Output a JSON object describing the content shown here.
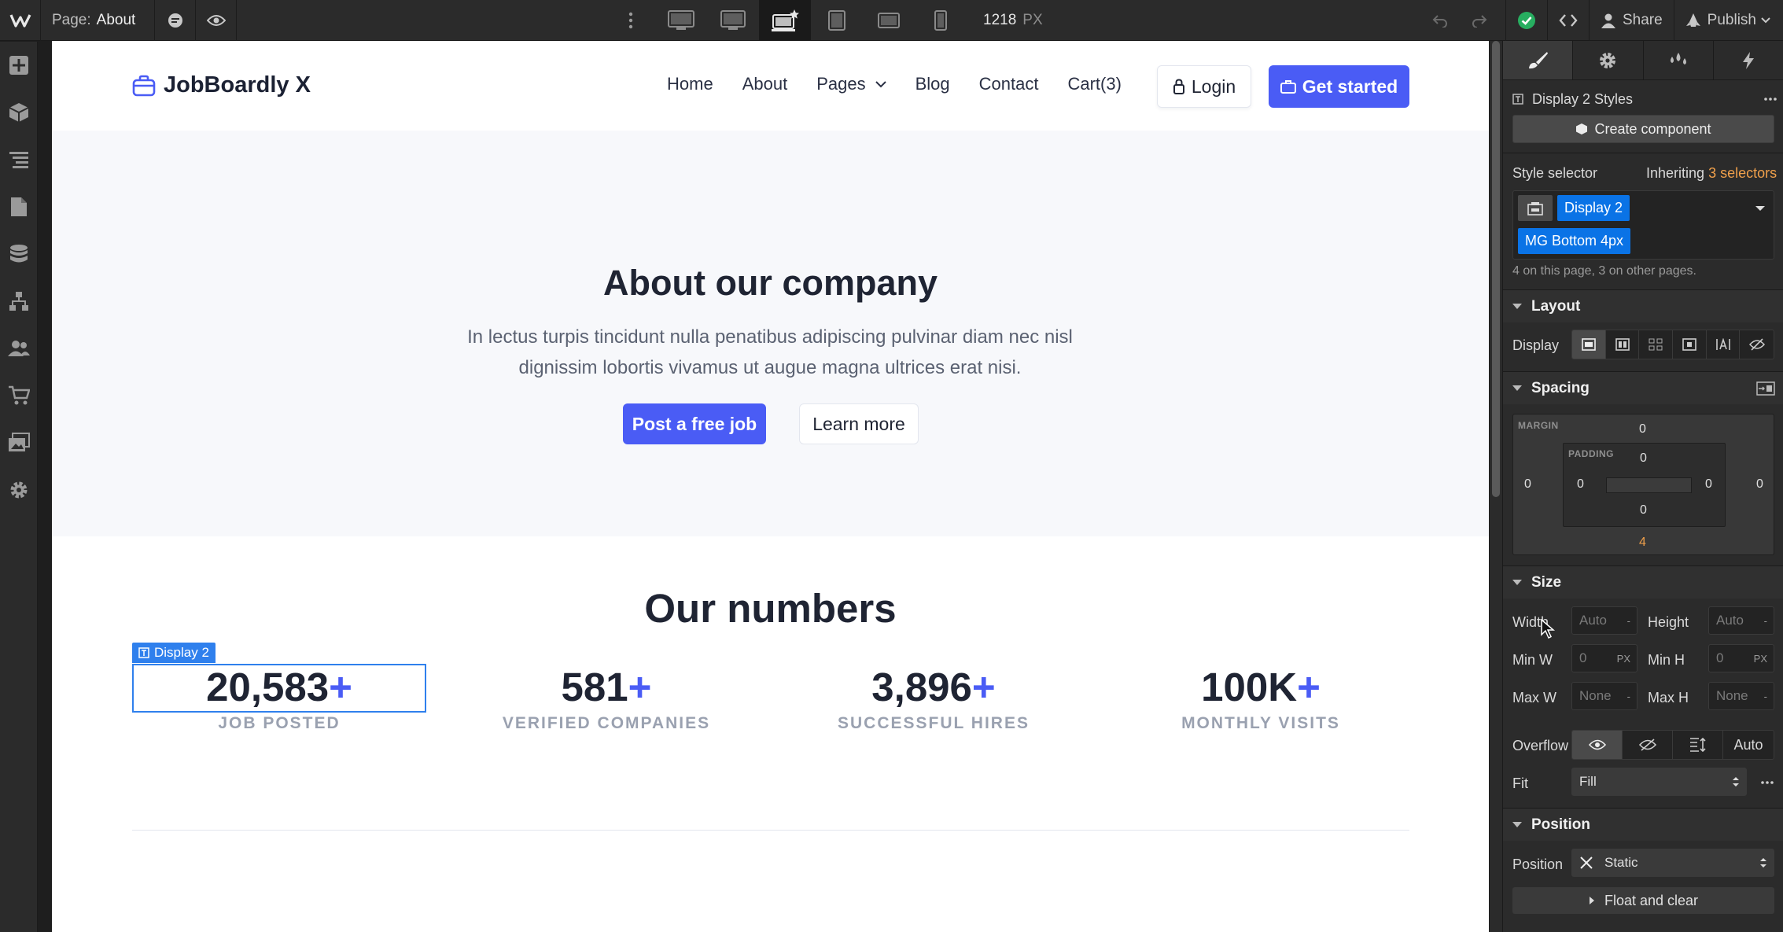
{
  "topbar": {
    "page_prefix": "Page:",
    "page_name": "About",
    "canvas_width": "1218",
    "canvas_unit": "PX",
    "share_label": "Share",
    "publish_label": "Publish"
  },
  "site": {
    "brand": "JobBoardly X",
    "menu": [
      "Home",
      "About",
      "Pages",
      "Blog",
      "Contact",
      "Cart(3)"
    ],
    "login_label": "Login",
    "get_started_label": "Get started",
    "hero_title": "About our company",
    "hero_text": "In lectus turpis tincidunt nulla penatibus adipiscing pulvinar diam nec nisl dignissim lobortis vivamus ut augue magna ultrices erat nisi.",
    "post_job_label": "Post a free job",
    "learn_more_label": "Learn more",
    "numbers_title": "Our numbers",
    "selected_tag": "Display 2",
    "stats": [
      {
        "value": "20,583",
        "plus": "+",
        "label": "JOB POSTED"
      },
      {
        "value": "581",
        "plus": "+",
        "label": "VERIFIED COMPANIES"
      },
      {
        "value": "3,896",
        "plus": "+",
        "label": "SUCCESSFUL HIRES"
      },
      {
        "value": "100K",
        "plus": "+",
        "label": "MONTHLY VISITS"
      }
    ]
  },
  "panel": {
    "styles_title": "Display 2 Styles",
    "create_component": "Create component",
    "style_selector": "Style selector",
    "inheriting": "Inheriting",
    "selectors_count": "3 selectors",
    "chip1": "Display 2",
    "chip2": "MG Bottom 4px",
    "usage_note": "4 on this page, 3 on other pages.",
    "layout": "Layout",
    "display": "Display",
    "spacing": "Spacing",
    "margin_label": "MARGIN",
    "padding_label": "PADDING",
    "margin": {
      "top": "0",
      "left": "0",
      "right": "0",
      "bottom": "4"
    },
    "padding": {
      "top": "0",
      "left": "0",
      "right": "0",
      "bottom": "0"
    },
    "size": "Size",
    "width": "Width",
    "height": "Height",
    "min_w": "Min W",
    "min_h": "Min H",
    "max_w": "Max W",
    "max_h": "Max H",
    "auto": "Auto",
    "zero": "0",
    "none": "None",
    "dash": "-",
    "px": "PX",
    "overflow": "Overflow",
    "overflow_auto": "Auto",
    "fit": "Fit",
    "fit_value": "Fill",
    "position_section": "Position",
    "position": "Position",
    "position_value": "Static",
    "float_clear": "Float and clear"
  },
  "colors": {
    "accent": "#4a5cf5",
    "selection": "#2f80ed",
    "chip": "#0a73e6",
    "highlight_orange": "#f0a04b",
    "publish_ok": "#27ae60"
  }
}
